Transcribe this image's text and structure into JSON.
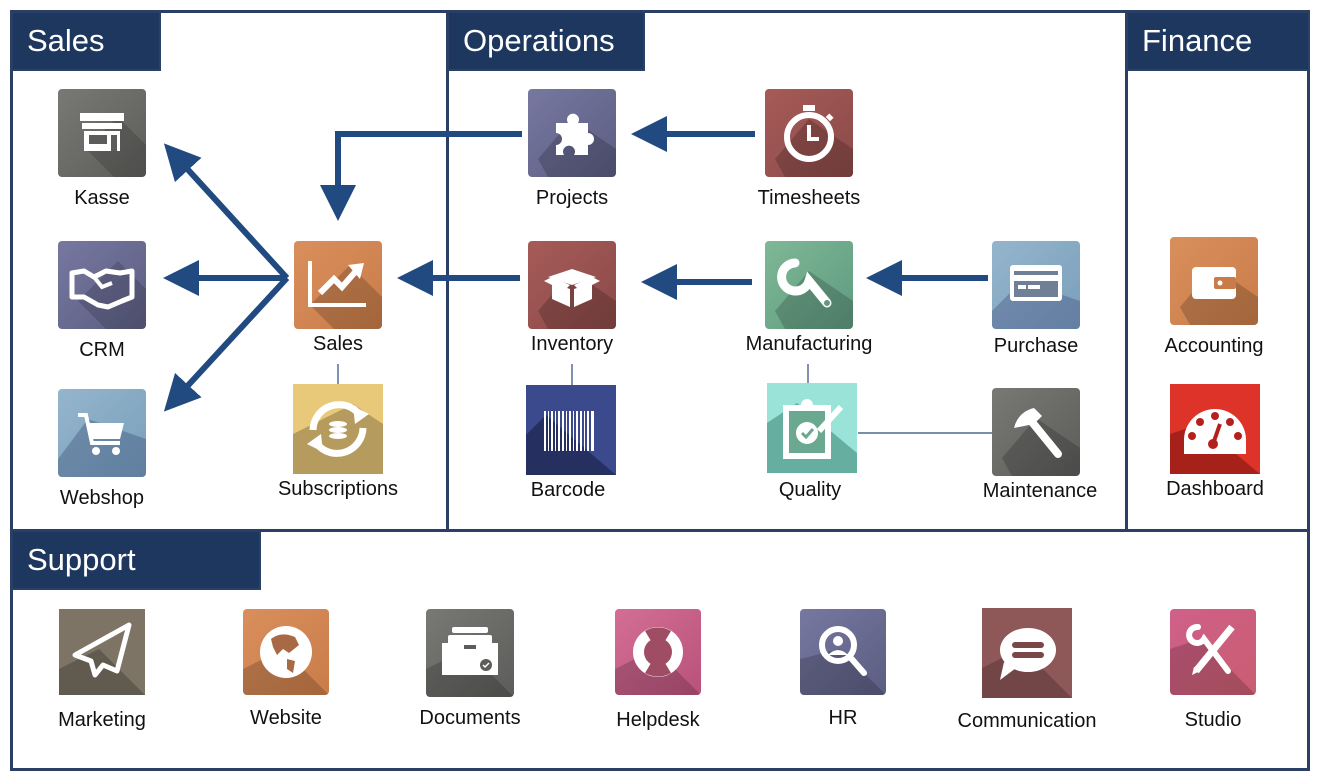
{
  "sections": {
    "sales": {
      "title": "Sales"
    },
    "operations": {
      "title": "Operations"
    },
    "finance": {
      "title": "Finance"
    },
    "support": {
      "title": "Support"
    }
  },
  "apps": {
    "kasse": {
      "label": "Kasse",
      "icon": "store-icon",
      "color": "#6b6c69"
    },
    "crm": {
      "label": "CRM",
      "icon": "handshake-icon",
      "color": "#6c6f97"
    },
    "webshop": {
      "label": "Webshop",
      "icon": "shopping-cart-icon",
      "color": "#89aac4"
    },
    "sales": {
      "label": "Sales",
      "icon": "trending-chart-icon",
      "color": "#cf8553"
    },
    "subscriptions": {
      "label": "Subscriptions",
      "icon": "recurring-coins-icon",
      "color": "#e8c97a"
    },
    "projects": {
      "label": "Projects",
      "icon": "puzzle-piece-icon",
      "color": "#6c6f97"
    },
    "timesheets": {
      "label": "Timesheets",
      "icon": "stopwatch-icon",
      "color": "#9c5553"
    },
    "inventory": {
      "label": "Inventory",
      "icon": "open-box-icon",
      "color": "#9c5553"
    },
    "manufacturing": {
      "label": "Manufacturing",
      "icon": "wrench-icon",
      "color": "#72a58a"
    },
    "purchase": {
      "label": "Purchase",
      "icon": "credit-card-icon",
      "color": "#89aac4"
    },
    "barcode": {
      "label": "Barcode",
      "icon": "barcode-icon",
      "color": "#3a4a8c"
    },
    "quality": {
      "label": "Quality",
      "icon": "clipboard-check-icon",
      "color": "#9ae3d9"
    },
    "maintenance": {
      "label": "Maintenance",
      "icon": "hammer-icon",
      "color": "#6b6c69"
    },
    "accounting": {
      "label": "Accounting",
      "icon": "wallet-icon",
      "color": "#cf8553"
    },
    "dashboard": {
      "label": "Dashboard",
      "icon": "gauge-icon",
      "color": "#de3329"
    },
    "marketing": {
      "label": "Marketing",
      "icon": "paper-plane-icon",
      "color": "#7d7466"
    },
    "website": {
      "label": "Website",
      "icon": "globe-icon",
      "color": "#cf8553"
    },
    "documents": {
      "label": "Documents",
      "icon": "file-drawer-icon",
      "color": "#6b6c69"
    },
    "helpdesk": {
      "label": "Helpdesk",
      "icon": "lifebuoy-icon",
      "color": "#c95d84"
    },
    "hr": {
      "label": "HR",
      "icon": "search-person-icon",
      "color": "#6c6f97"
    },
    "communication": {
      "label": "Communication",
      "icon": "chat-bubble-icon",
      "color": "#8f5858"
    },
    "studio": {
      "label": "Studio",
      "icon": "tools-icon",
      "color": "#c95d7a"
    }
  },
  "flows": [
    {
      "from": "Timesheets",
      "to": "Projects"
    },
    {
      "from": "Projects",
      "to": "Sales"
    },
    {
      "from": "Purchase",
      "to": "Manufacturing"
    },
    {
      "from": "Manufacturing",
      "to": "Inventory"
    },
    {
      "from": "Inventory",
      "to": "Sales"
    },
    {
      "from": "Sales",
      "to": "Kasse"
    },
    {
      "from": "Sales",
      "to": "CRM"
    },
    {
      "from": "Sales",
      "to": "Webshop"
    }
  ],
  "links": [
    {
      "a": "Sales",
      "b": "Subscriptions"
    },
    {
      "a": "Inventory",
      "b": "Barcode"
    },
    {
      "a": "Manufacturing",
      "b": "Quality"
    },
    {
      "a": "Quality",
      "b": "Maintenance"
    }
  ],
  "colors": {
    "frame": "#2a3f63",
    "header": "#1e375f",
    "arrow": "#214a80"
  }
}
